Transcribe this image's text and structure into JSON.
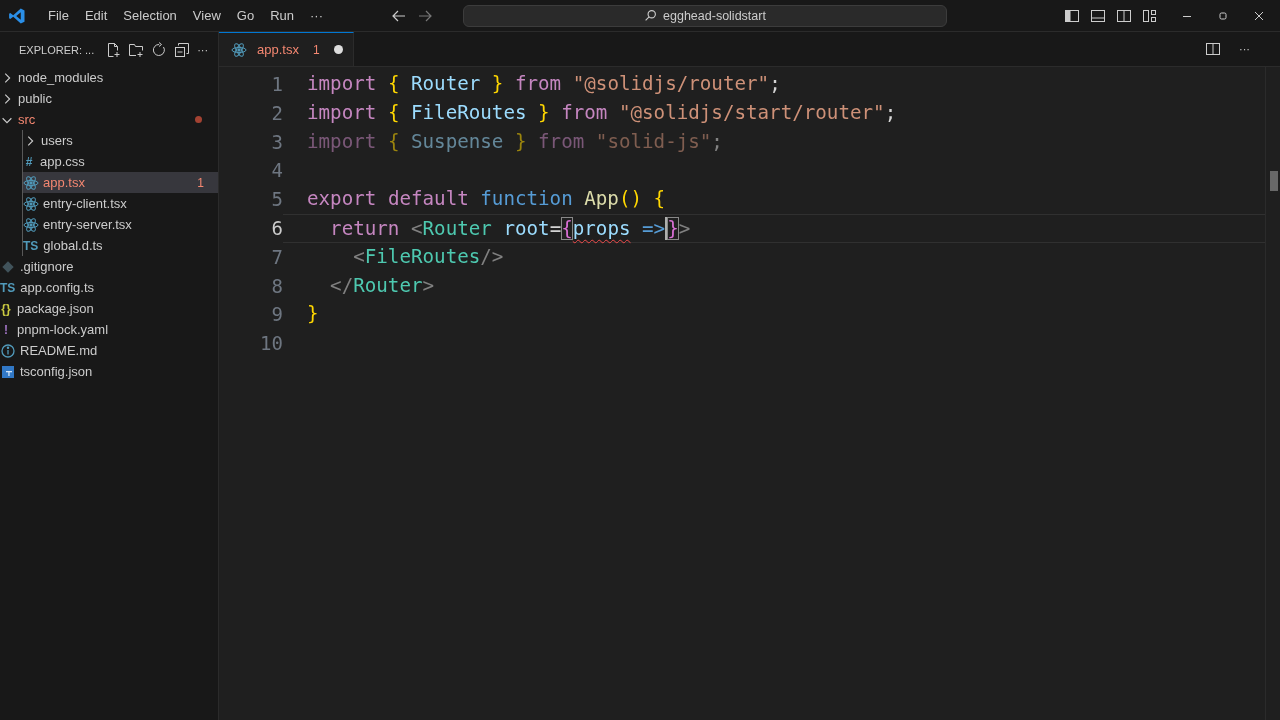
{
  "menu": [
    "File",
    "Edit",
    "Selection",
    "View",
    "Go",
    "Run"
  ],
  "menu_more": "···",
  "search": {
    "value": "egghead-solidstart"
  },
  "sidebar": {
    "title": "EXPLORER: ...",
    "items": [
      {
        "label": "node_modules",
        "kind": "folder",
        "expanded": false,
        "selected": false,
        "error": false
      },
      {
        "label": "public",
        "kind": "folder",
        "expanded": false,
        "selected": false,
        "error": false
      },
      {
        "label": "src",
        "kind": "folder",
        "expanded": true,
        "selected": false,
        "error": true,
        "children": [
          {
            "label": "users",
            "kind": "folder",
            "expanded": false,
            "selected": false,
            "error": false
          },
          {
            "label": "app.css",
            "kind": "css",
            "glyph": "#",
            "selected": false,
            "error": false
          },
          {
            "label": "app.tsx",
            "kind": "react",
            "selected": true,
            "error": true,
            "badge": "1"
          },
          {
            "label": "entry-client.tsx",
            "kind": "react",
            "selected": false,
            "error": false
          },
          {
            "label": "entry-server.tsx",
            "kind": "react",
            "selected": false,
            "error": false
          },
          {
            "label": "global.d.ts",
            "kind": "ts",
            "glyph": "TS",
            "selected": false,
            "error": false
          }
        ]
      },
      {
        "label": ".gitignore",
        "kind": "git",
        "selected": false,
        "error": false
      },
      {
        "label": "app.config.ts",
        "kind": "ts",
        "glyph": "TS",
        "selected": false,
        "error": false
      },
      {
        "label": "package.json",
        "kind": "json",
        "glyph": "{}",
        "selected": false,
        "error": false
      },
      {
        "label": "pnpm-lock.yaml",
        "kind": "yaml",
        "glyph": "!",
        "selected": false,
        "error": false
      },
      {
        "label": "README.md",
        "kind": "info",
        "selected": false,
        "error": false
      },
      {
        "label": "tsconfig.json",
        "kind": "tsconfig",
        "selected": false,
        "error": false
      }
    ]
  },
  "tabs": [
    {
      "label": "app.tsx",
      "badge": "1",
      "dirty": true,
      "selected": true,
      "error": true
    }
  ],
  "editor": {
    "lines": [
      {
        "number": "1",
        "current": false,
        "dimmed": false,
        "tokens": [
          {
            "t": "import ",
            "kind": "keyword"
          },
          {
            "t": "{ ",
            "kind": "bracket1"
          },
          {
            "t": "Router ",
            "kind": "variable"
          },
          {
            "t": "} ",
            "kind": "bracket1"
          },
          {
            "t": "from ",
            "kind": "keyword"
          },
          {
            "t": "\"@solidjs/router\"",
            "kind": "string"
          },
          {
            "t": ";",
            "kind": "punct"
          }
        ]
      },
      {
        "number": "2",
        "current": false,
        "dimmed": false,
        "tokens": [
          {
            "t": "import ",
            "kind": "keyword"
          },
          {
            "t": "{ ",
            "kind": "bracket1"
          },
          {
            "t": "FileRoutes ",
            "kind": "variable"
          },
          {
            "t": "} ",
            "kind": "bracket1"
          },
          {
            "t": "from ",
            "kind": "keyword"
          },
          {
            "t": "\"@solidjs/start/router\"",
            "kind": "string"
          },
          {
            "t": ";",
            "kind": "punct"
          }
        ]
      },
      {
        "number": "3",
        "current": false,
        "dimmed": true,
        "tokens": [
          {
            "t": "import ",
            "kind": "keyword"
          },
          {
            "t": "{ ",
            "kind": "bracket1"
          },
          {
            "t": "Suspense ",
            "kind": "variable"
          },
          {
            "t": "} ",
            "kind": "bracket1"
          },
          {
            "t": "from ",
            "kind": "keyword"
          },
          {
            "t": "\"solid-js\"",
            "kind": "string"
          },
          {
            "t": ";",
            "kind": "punct"
          }
        ]
      },
      {
        "number": "4",
        "current": false
      },
      {
        "number": "5",
        "current": false,
        "dimmed": false,
        "tokens": [
          {
            "t": "export ",
            "kind": "keyword"
          },
          {
            "t": "default ",
            "kind": "keyword"
          },
          {
            "t": "function ",
            "kind": "storage"
          },
          {
            "t": "App",
            "kind": "func"
          },
          {
            "t": "() ",
            "kind": "bracket1"
          },
          {
            "t": "{",
            "kind": "bracket1"
          }
        ]
      },
      {
        "number": "6",
        "current": true,
        "dimmed": false,
        "tokens": [
          {
            "t": "  return ",
            "kind": "keyword"
          },
          {
            "t": "<",
            "kind": "tagpunct"
          },
          {
            "t": "Router ",
            "kind": "tag"
          },
          {
            "t": "root",
            "kind": "variable"
          },
          {
            "t": "=",
            "kind": "punct"
          },
          {
            "t": "{",
            "kind": "bracket2",
            "matched": true
          },
          {
            "t": "props",
            "kind": "variable",
            "error": true
          },
          {
            "t": " =>",
            "kind": "storage",
            "cursor": true
          },
          {
            "t": "}",
            "kind": "bracket2",
            "matched": true
          },
          {
            "t": ">",
            "kind": "tagpunct"
          }
        ]
      },
      {
        "number": "7",
        "current": false,
        "dimmed": false,
        "tokens": [
          {
            "t": "    <",
            "kind": "tagpunct"
          },
          {
            "t": "FileRoutes",
            "kind": "tag"
          },
          {
            "t": "/>",
            "kind": "tagpunct"
          }
        ]
      },
      {
        "number": "8",
        "current": false,
        "dimmed": false,
        "tokens": [
          {
            "t": "  </",
            "kind": "tagpunct"
          },
          {
            "t": "Router",
            "kind": "tag"
          },
          {
            "t": ">",
            "kind": "tagpunct"
          }
        ]
      },
      {
        "number": "9",
        "current": false,
        "dimmed": false,
        "tokens": [
          {
            "t": "}",
            "kind": "bracket1"
          }
        ]
      },
      {
        "number": "10",
        "current": false
      }
    ]
  }
}
